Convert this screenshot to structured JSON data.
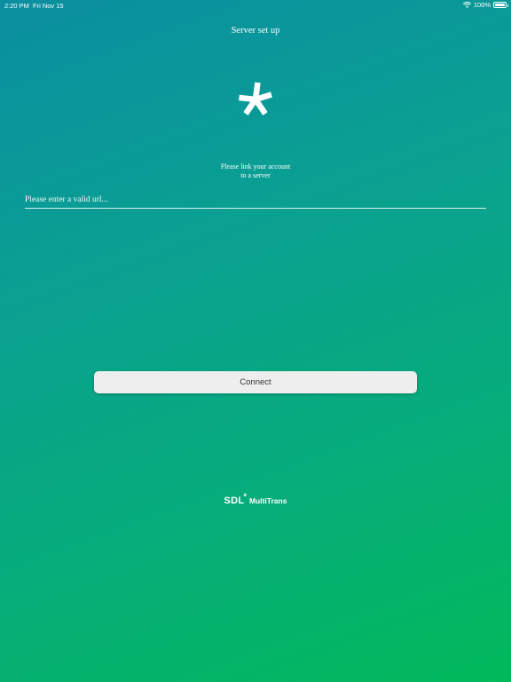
{
  "status_bar": {
    "time": "2:20 PM",
    "date": "Fri Nov 15",
    "battery": "100%",
    "battery_level": 1.0
  },
  "header": {
    "title": "Server set up"
  },
  "logo": {
    "icon": "asterisk-icon",
    "color": "#ffffff"
  },
  "prompt": {
    "line1": "Please link your account",
    "line2": "to a server"
  },
  "url_input": {
    "placeholder": "Please enter a valid url...",
    "value": ""
  },
  "connect_button": {
    "label": "Connect"
  },
  "footer": {
    "brand": "SDL",
    "brand_mark": "*",
    "product": "MultiTrans"
  },
  "colors": {
    "background_top": "#0a8ea0",
    "background_bottom": "#02b95a",
    "button_bg": "#efeeef",
    "button_text": "#333333"
  }
}
